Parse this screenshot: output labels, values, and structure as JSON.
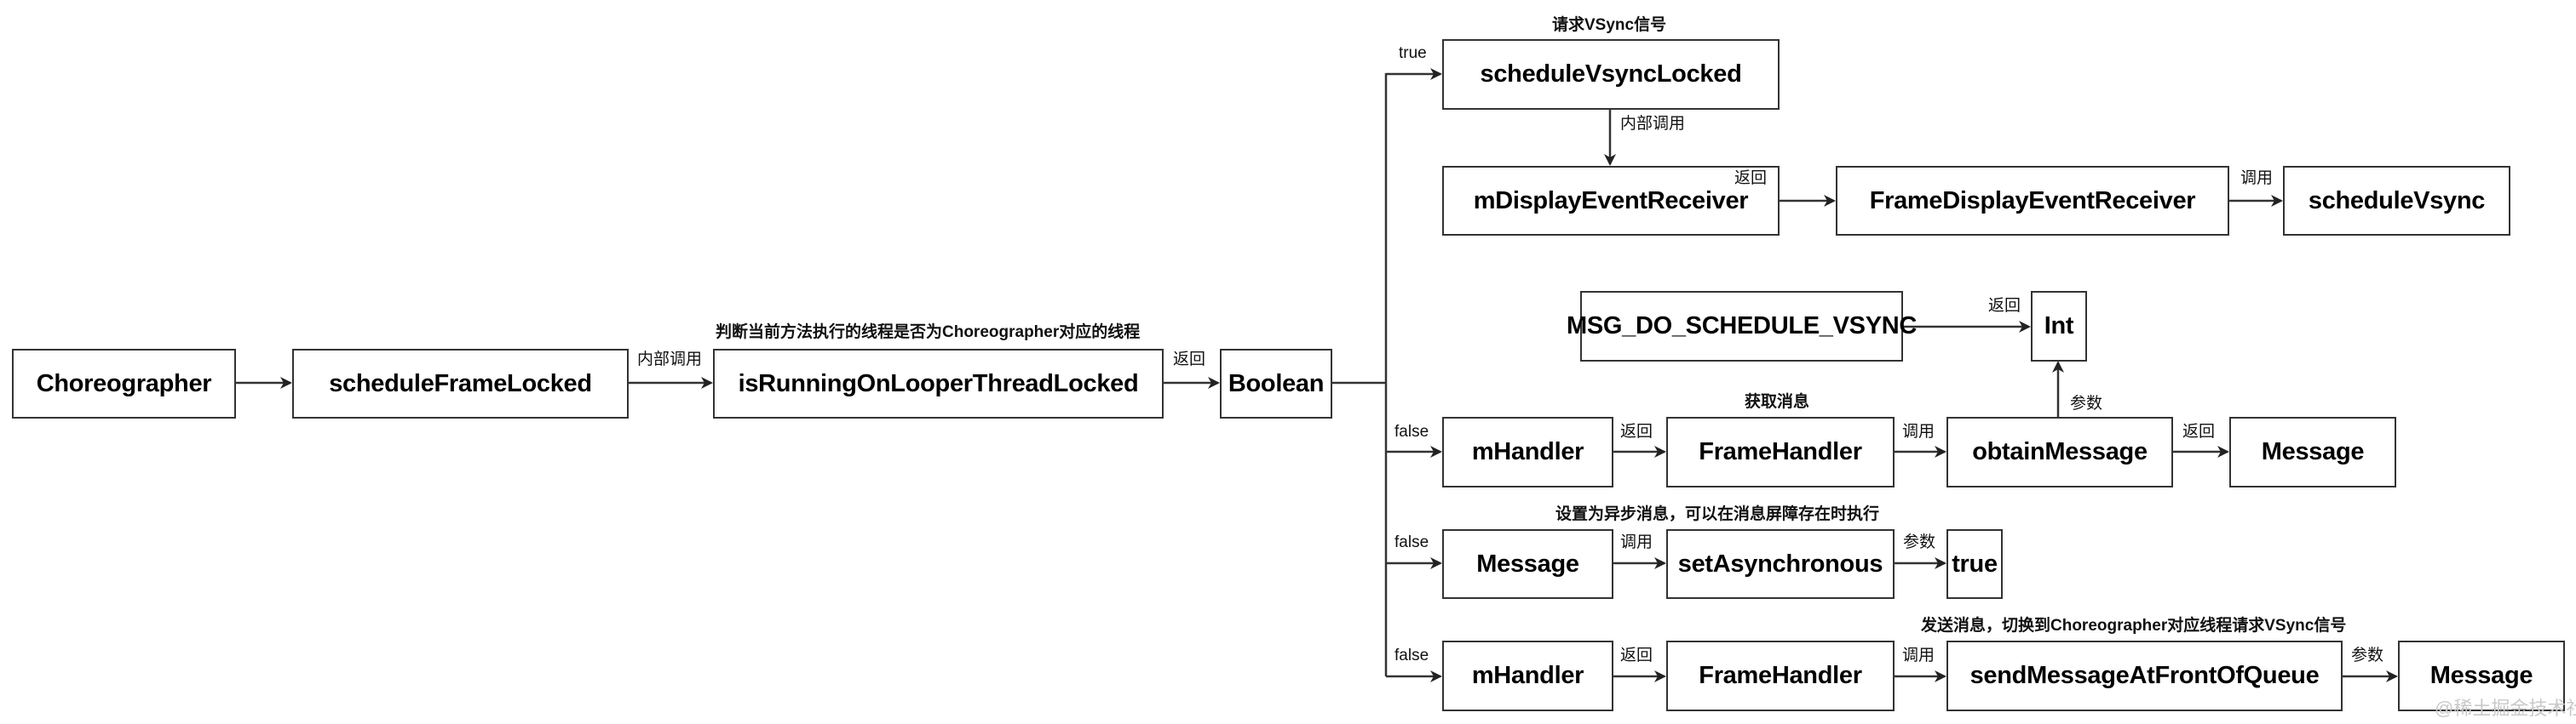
{
  "diagram": {
    "nodes": {
      "choreographer": "Choreographer",
      "schedule_frame_locked": "scheduleFrameLocked",
      "is_running_on_looper": "isRunningOnLooperThreadLocked",
      "boolean": "Boolean",
      "schedule_vsync_locked": "scheduleVsyncLocked",
      "m_display_event_receiver": "mDisplayEventReceiver",
      "frame_display_event_receiver": "FrameDisplayEventReceiver",
      "schedule_vsync": "scheduleVsync",
      "msg_do_schedule_vsync": "MSG_DO_SCHEDULE_VSYNC",
      "int": "Int",
      "m_handler_1": "mHandler",
      "frame_handler_1": "FrameHandler",
      "obtain_message": "obtainMessage",
      "message_1": "Message",
      "message_2": "Message",
      "set_asynchronous": "setAsynchronous",
      "true_value": "true",
      "m_handler_2": "mHandler",
      "frame_handler_2": "FrameHandler",
      "send_message_at_front": "sendMessageAtFrontOfQueue",
      "message_3": "Message"
    },
    "edge_labels": {
      "internal_call_1": "内部调用",
      "return_boolean": "返回",
      "branch_true": "true",
      "internal_call_2": "内部调用",
      "return_frame_display": "返回",
      "call_schedule_vsync": "调用",
      "return_int": "返回",
      "branch_false_1": "false",
      "return_frame_handler_1": "返回",
      "call_obtain_message": "调用",
      "return_message": "返回",
      "param_int": "参数",
      "branch_false_2": "false",
      "call_set_async": "调用",
      "param_true": "参数",
      "branch_false_3": "false",
      "return_frame_handler_2": "返回",
      "call_send_message": "调用",
      "param_message": "参数"
    },
    "notes": {
      "is_running_note": "判断当前方法执行的线程是否为Choreographer对应的线程",
      "request_vsync_note": "请求VSync信号",
      "obtain_message_note": "获取消息",
      "set_async_note": "设置为异步消息，可以在消息屏障存在时执行",
      "send_message_note": "发送消息，切换到Choreographer对应线程请求VSync信号"
    },
    "watermark": "@稀土掘金技术社区",
    "colors": {
      "stroke": "#333333",
      "text": "#000000",
      "background": "#ffffff",
      "watermark": "#c9c9c9"
    }
  }
}
